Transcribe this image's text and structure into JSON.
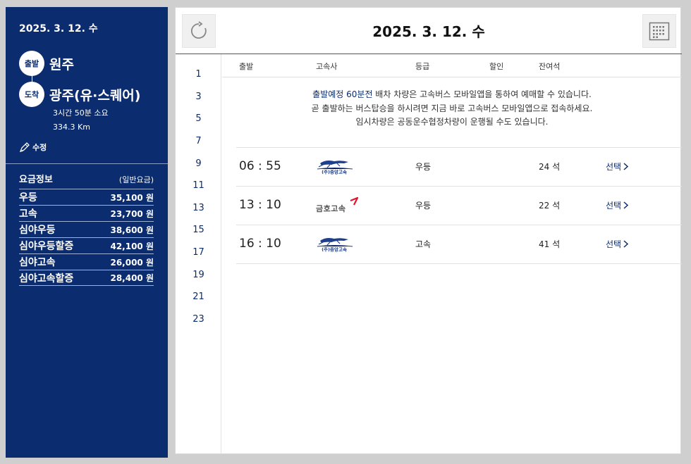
{
  "sidebar": {
    "date": "2025. 3. 12. 수",
    "departure_label": "출발",
    "departure": "원주",
    "arrival_label": "도착",
    "arrival": "광주(유·스퀘어)",
    "duration": "3시간 50분 소요",
    "distance": "334.3 Km",
    "edit_label": "수정",
    "fare_title": "요금정보",
    "fare_subtitle": "(일반요금)",
    "fares": [
      {
        "name": "우등",
        "price": "35,100 원"
      },
      {
        "name": "고속",
        "price": "23,700 원"
      },
      {
        "name": "심야우등",
        "price": "38,600 원"
      },
      {
        "name": "심야우등할증",
        "price": "42,100 원"
      },
      {
        "name": "심야고속",
        "price": "26,000 원"
      },
      {
        "name": "심야고속할증",
        "price": "28,400 원"
      }
    ]
  },
  "main": {
    "date": "2025. 3. 12. 수",
    "hours": [
      "1",
      "3",
      "5",
      "7",
      "9",
      "11",
      "13",
      "15",
      "17",
      "19",
      "21",
      "23"
    ],
    "columns": {
      "departure": "출발",
      "company": "고속사",
      "grade": "등급",
      "discount": "할인",
      "seats": "잔여석"
    },
    "notice": {
      "highlight": "출발예정 60분전",
      "line1_rest": " 배차 차량은 고속버스 모바일앱을 통하여 예매할 수 있습니다.",
      "line2": "곧 출발하는 버스탑승을 하시려면 지금 바로 고속버스 모바일앱으로 접속하세요.",
      "line3": "임시차량은 공동운수협정차량이 운행될 수도 있습니다."
    },
    "select_label": "선택",
    "rows": [
      {
        "time": "06 : 55",
        "company_logo": "(주)중앙고속",
        "grade": "우등",
        "seats": "24 석"
      },
      {
        "time": "13 : 10",
        "company_logo": "금호고속",
        "grade": "우등",
        "seats": "22 석"
      },
      {
        "time": "16 : 10",
        "company_logo": "(주)중앙고속",
        "grade": "고속",
        "seats": "41 석"
      }
    ]
  },
  "colors": {
    "sidebar_bg": "#0b2c6e",
    "accent": "#0b2c6e",
    "kumho_red": "#e0182d"
  },
  "icons": {
    "refresh": "refresh-icon",
    "calendar": "calendar-icon",
    "edit": "pen-icon",
    "chevron": "chevron-right-icon"
  }
}
